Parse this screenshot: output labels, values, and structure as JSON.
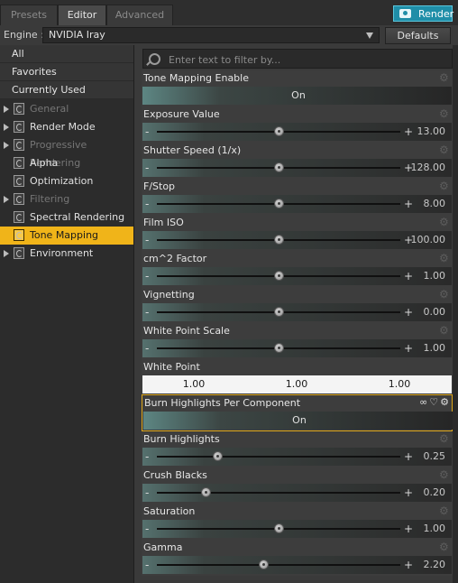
{
  "tabs": [
    {
      "label": "Presets",
      "active": false
    },
    {
      "label": "Editor",
      "active": true
    },
    {
      "label": "Advanced",
      "active": false
    }
  ],
  "render_button": {
    "label": "Render",
    "icon": "camera-icon",
    "color": "#1f8ea8"
  },
  "engine": {
    "label": "Engine :",
    "value": "NVIDIA Iray",
    "defaults_label": "Defaults"
  },
  "sidebar": {
    "items": [
      {
        "label": "All",
        "kind": "plain"
      },
      {
        "label": "Favorites",
        "kind": "plain"
      },
      {
        "label": "Currently Used",
        "kind": "plain"
      },
      {
        "label": "General",
        "kind": "group",
        "disabled": true,
        "expandable": true
      },
      {
        "label": "Render Mode",
        "kind": "group",
        "disabled": false,
        "expandable": true
      },
      {
        "label": "Progressive Rendering",
        "kind": "group",
        "disabled": true,
        "expandable": true
      },
      {
        "label": "Alpha",
        "kind": "group",
        "disabled": false,
        "expandable": false
      },
      {
        "label": "Optimization",
        "kind": "group",
        "disabled": false,
        "expandable": false
      },
      {
        "label": "Filtering",
        "kind": "group",
        "disabled": true,
        "expandable": true
      },
      {
        "label": "Spectral Rendering",
        "kind": "group",
        "disabled": false,
        "expandable": false
      },
      {
        "label": "Tone Mapping",
        "kind": "group",
        "disabled": false,
        "expandable": false,
        "selected": true
      },
      {
        "label": "Environment",
        "kind": "group",
        "disabled": false,
        "expandable": true
      }
    ],
    "selected_color": "#f0b419"
  },
  "filter": {
    "placeholder": "Enter text to filter by..."
  },
  "properties": [
    {
      "label": "Tone Mapping Enable",
      "type": "toggle",
      "value": "On"
    },
    {
      "label": "Exposure Value",
      "type": "slider",
      "value": "13.00",
      "level": 0.5
    },
    {
      "label": "Shutter Speed (1/x)",
      "type": "slider",
      "value": "128.00",
      "level": 0.5
    },
    {
      "label": "F/Stop",
      "type": "slider",
      "value": "8.00",
      "level": 0.5
    },
    {
      "label": "Film ISO",
      "type": "slider",
      "value": "100.00",
      "level": 0.5
    },
    {
      "label": "cm^2 Factor",
      "type": "slider",
      "value": "1.00",
      "level": 0.5
    },
    {
      "label": "Vignetting",
      "type": "slider",
      "value": "0.00",
      "level": 0.5
    },
    {
      "label": "White Point Scale",
      "type": "slider",
      "value": "1.00",
      "level": 0.5
    },
    {
      "label": "White Point",
      "type": "color",
      "values": [
        "1.00",
        "1.00",
        "1.00"
      ]
    },
    {
      "label": "Burn Highlights Per Component",
      "type": "toggle",
      "value": "On",
      "highlighted": true
    },
    {
      "label": "Burn Highlights",
      "type": "slider",
      "value": "0.25",
      "level": 0.25
    },
    {
      "label": "Crush Blacks",
      "type": "slider",
      "value": "0.20",
      "level": 0.2
    },
    {
      "label": "Saturation",
      "type": "slider",
      "value": "1.00",
      "level": 0.5
    },
    {
      "label": "Gamma",
      "type": "slider",
      "value": "2.20",
      "level": 0.44
    }
  ]
}
